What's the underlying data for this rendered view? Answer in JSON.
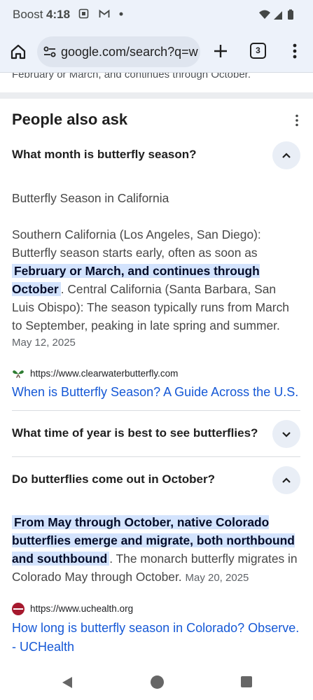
{
  "status_bar": {
    "carrier": "Boost",
    "time": "4:18",
    "icons": [
      "screenshot-icon",
      "gmail-icon",
      "dot-icon",
      "wifi-icon",
      "signal-icon",
      "battery-icon"
    ]
  },
  "toolbar": {
    "url": "google.com/search?q=w",
    "tab_count": "3",
    "icons": [
      "home-icon",
      "tune-icon",
      "plus-icon",
      "tabs-icon",
      "menu-icon"
    ]
  },
  "clipped_text": "February or March, and continues through October.",
  "paa": {
    "title": "People also ask",
    "questions": [
      {
        "question": "What month is butterfly season?",
        "expanded": true,
        "answer_heading": "Butterfly Season in California",
        "answer_pre": "Southern California (Los Angeles, San Diego): Butterfly season starts early, often as soon as",
        "answer_highlight": "February or March, and continues through October",
        "answer_post": ". Central California (Santa Barbara, San Luis Obispo): The season typically runs from March to September, peaking in late spring and summer.",
        "date": "May 12, 2025",
        "source_url": "https://www.clearwaterbutterfly.com",
        "source_title": "When is Butterfly Season? A Guide Across the U.S."
      },
      {
        "question": "What time of year is best to see butterflies?",
        "expanded": false
      },
      {
        "question": "Do butterflies come out in October?",
        "expanded": true,
        "answer_highlight": "From May through October, native Colorado butterflies emerge and migrate, both northbound and southbound",
        "answer_post": ". The monarch butterfly migrates in Colorado May through October.",
        "date": "May 20, 2025",
        "source_url": "https://www.uchealth.org",
        "source_title": "How long is butterfly season in Colorado? Observe. - UCHealth"
      }
    ]
  },
  "colors": {
    "highlight": "#d3e3fd",
    "link": "#1558d6",
    "toolbar_bg": "#edf2fa"
  }
}
